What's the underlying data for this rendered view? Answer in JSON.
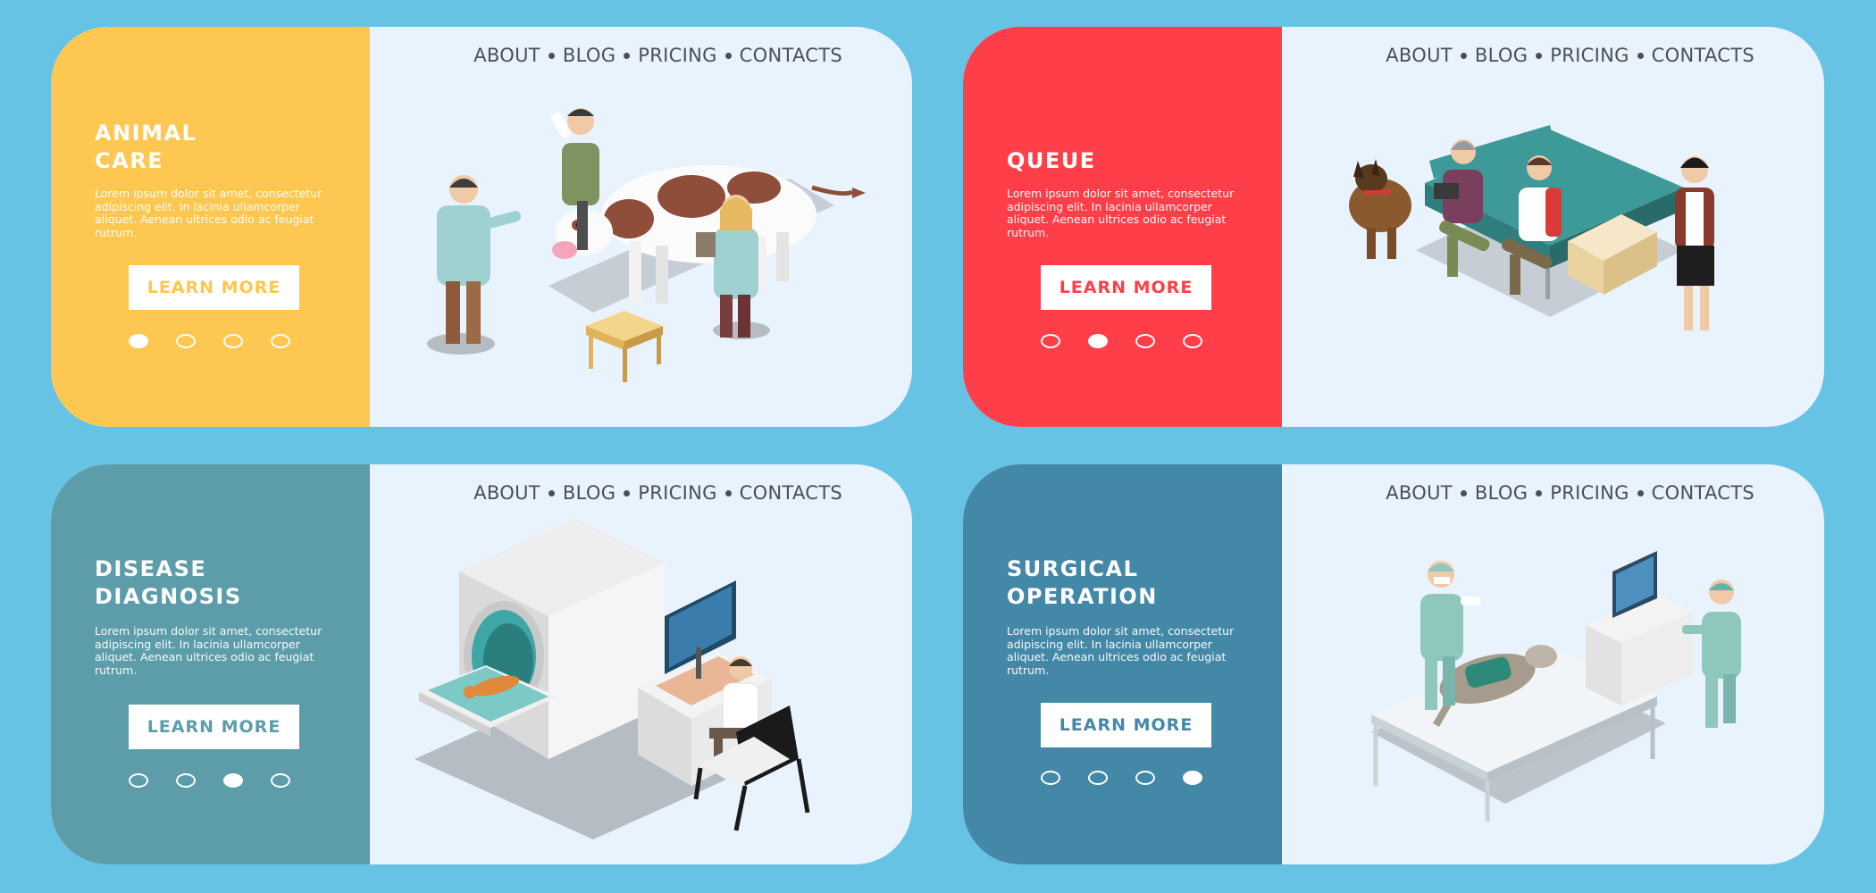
{
  "nav": [
    "ABOUT",
    "BLOG",
    "PRICING",
    "CONTACTS"
  ],
  "colors": {
    "background": "#66c3e4",
    "yellow": "#fec751",
    "red": "#fe3f49",
    "teal": "#5d9daa",
    "blue": "#4488a8",
    "panel": "#e9f3fd"
  },
  "banners": [
    {
      "title": "ANIMAL\nCARE",
      "body": "Lorem ipsum dolor sit amet, consectetur adipiscing elit. In lacinia ullamcorper aliquet. Aenean ultrices odio ac feugiat rutrum.",
      "button": "LEARN MORE",
      "active_dot": 1
    },
    {
      "title": "QUEUE",
      "body": "Lorem ipsum dolor sit amet, consectetur adipiscing elit. In lacinia ullamcorper aliquet. Aenean ultrices odio ac feugiat rutrum.",
      "button": "LEARN MORE",
      "active_dot": 2
    },
    {
      "title": "DISEASE\nDIAGNOSIS",
      "body": "Lorem ipsum dolor sit amet, consectetur adipiscing elit. In lacinia ullamcorper aliquet. Aenean ultrices odio ac feugiat rutrum.",
      "button": "LEARN MORE",
      "active_dot": 3
    },
    {
      "title": "SURGICAL\nOPERATION",
      "body": "Lorem ipsum dolor sit amet, consectetur adipiscing elit. In lacinia ullamcorper aliquet. Aenean ultrices odio ac feugiat rutrum.",
      "button": "LEARN MORE",
      "active_dot": 4
    }
  ],
  "illustrations": [
    "cow-exam-illustration",
    "waiting-room-illustration",
    "mri-scan-illustration",
    "surgery-illustration"
  ]
}
